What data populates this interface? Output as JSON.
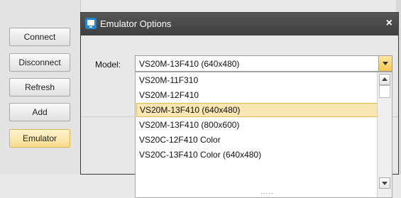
{
  "left_buttons": [
    {
      "label": "Connect"
    },
    {
      "label": "Disconnect"
    },
    {
      "label": "Refresh"
    },
    {
      "label": "Add"
    },
    {
      "label": "Emulator"
    }
  ],
  "dialog": {
    "title": "Emulator Options",
    "close_icon": "close-icon",
    "model_label": "Model:",
    "selected_model": "VS20M-13F410 (640x480)",
    "options": [
      "VS20M-11F310",
      "VS20M-12F410",
      "VS20M-13F410 (640x480)",
      "VS20M-13F410 (800x600)",
      "VS20C-12F410 Color",
      "VS20C-13F410 Color (640x480)"
    ],
    "grip": "....."
  },
  "colors": {
    "accent": "#f6c94f",
    "titlebar": "#4a4a4a",
    "selection": "#f8e6b3"
  }
}
